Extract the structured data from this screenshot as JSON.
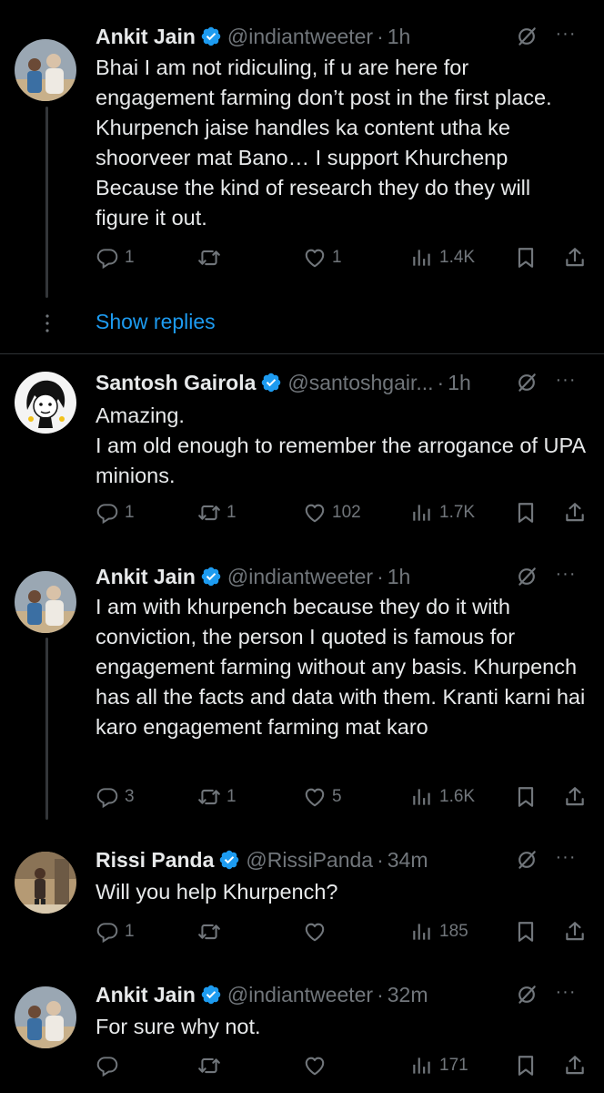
{
  "tweets": [
    {
      "name": "Ankit Jain",
      "handle": "@indiantweeter",
      "dot": "·",
      "time": "1h",
      "text": "Bhai I am not ridiculing, if u are here for engagement farming don’t post in the first place. Khurpench jaise handles ka content utha ke shoorveer mat Bano… I support Khurchenp Because the kind of research they do they will figure it out.",
      "replies": "1",
      "retweets": "",
      "likes": "1",
      "views": "1.4K"
    },
    {
      "name": "Santosh Gairola",
      "handle": "@santoshgair...",
      "dot": "·",
      "time": "1h",
      "text": "Amazing.\nI am old enough to remember the arrogance of UPA minions.",
      "replies": "1",
      "retweets": "1",
      "likes": "102",
      "views": "1.7K"
    },
    {
      "name": "Ankit Jain",
      "handle": "@indiantweeter",
      "dot": "·",
      "time": "1h",
      "text": "I am with khurpench because they do it with conviction, the person I quoted is famous for engagement farming without any basis. Khurpench has all the facts and data with them. Kranti karni hai karo engagement farming mat karo",
      "replies": "3",
      "retweets": "1",
      "likes": "5",
      "views": "1.6K"
    },
    {
      "name": "Rissi Panda",
      "handle": "@RissiPanda",
      "dot": "·",
      "time": "34m",
      "text": "Will you help Khurpench?",
      "replies": "1",
      "retweets": "",
      "likes": "",
      "views": "185"
    },
    {
      "name": "Ankit Jain",
      "handle": "@indiantweeter",
      "dot": "·",
      "time": "32m",
      "text": "For sure why not.",
      "replies": "",
      "retweets": "",
      "likes": "",
      "views": "171"
    }
  ],
  "show_replies_label": "Show replies",
  "more_label": "···",
  "colors": {
    "background": "#000000",
    "text_primary": "#e7e9ea",
    "text_secondary": "#71767b",
    "accent": "#1d9bf0",
    "divider": "#2f3336"
  },
  "icons": [
    "verified-badge-icon",
    "grok-icon",
    "more-icon",
    "reply-icon",
    "retweet-icon",
    "like-icon",
    "views-icon",
    "bookmark-icon",
    "share-icon"
  ]
}
